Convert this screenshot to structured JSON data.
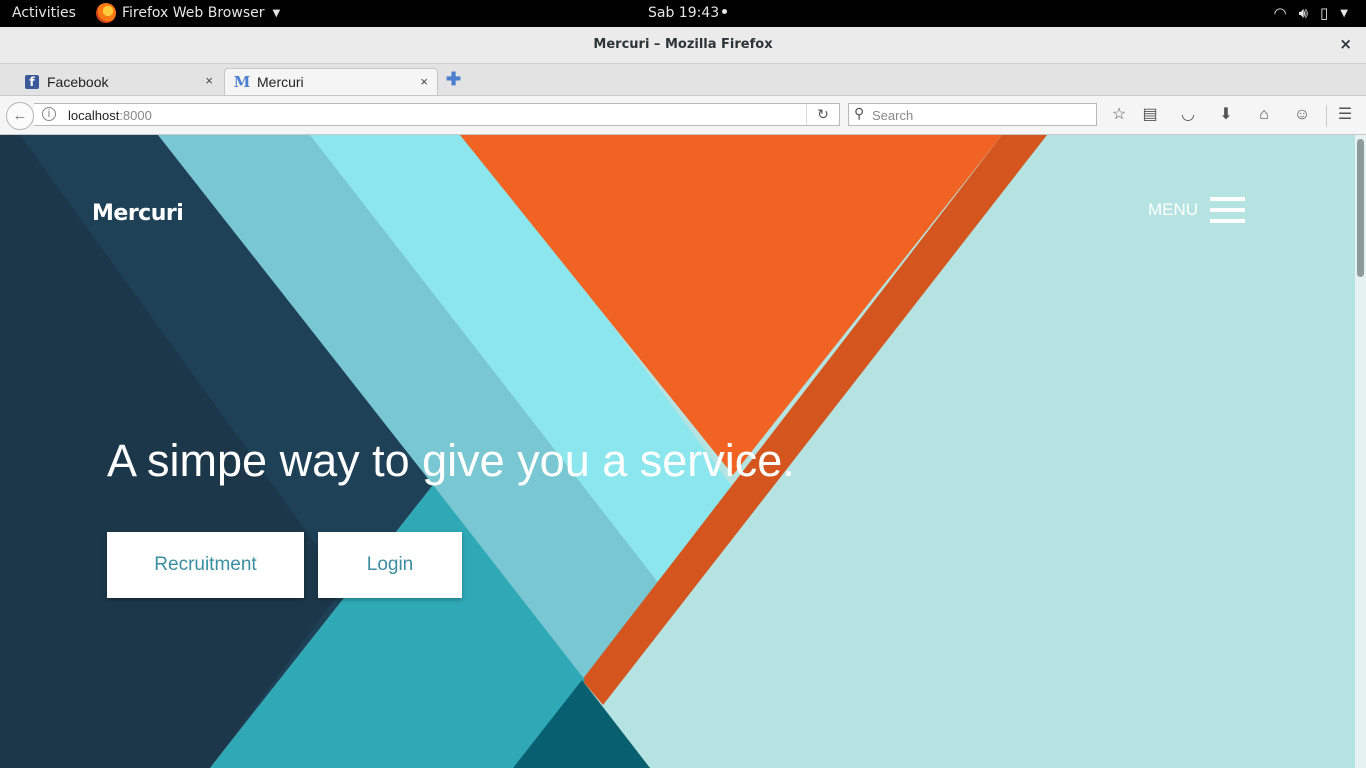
{
  "topbar": {
    "activities": "Activities",
    "app_name": "Firefox Web Browser",
    "clock": "Sab 19:43",
    "tray_icons": [
      "wifi-icon",
      "volume-icon",
      "battery-icon",
      "system-menu-caret-icon"
    ]
  },
  "window": {
    "title": "Mercuri – Mozilla Firefox",
    "close": "×"
  },
  "tabs": [
    {
      "label": "Facebook",
      "favicon": "facebook-icon",
      "close": "×"
    },
    {
      "label": "Mercuri",
      "favicon": "M",
      "close": "×",
      "active": true
    }
  ],
  "navbar": {
    "url_host": "localhost",
    "url_port": ":8000",
    "search_placeholder": "Search",
    "buttons": [
      "bookmark-star-icon",
      "reading-list-icon",
      "pocket-icon",
      "download-icon",
      "home-icon",
      "hello-icon",
      "hamburger-menu-icon"
    ]
  },
  "page": {
    "brand": "Mercuri",
    "menu_label": "MENU",
    "hero": "A simpe way to give you a service.",
    "buttons": {
      "recruitment": "Recruitment",
      "login": "Login"
    },
    "colors": {
      "navy": "#1c3a4e",
      "teal": "#2fa9b6",
      "sky": "#8ce6ee",
      "orange": "#f06322",
      "mint": "#b5e3e1",
      "button_text": "#3a8ea0"
    }
  }
}
